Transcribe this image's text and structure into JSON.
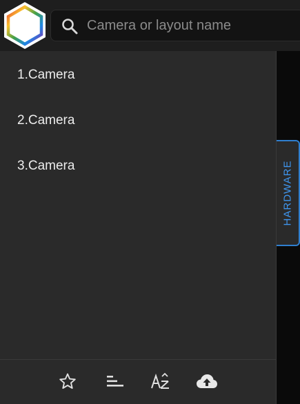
{
  "search": {
    "placeholder": "Camera or layout name",
    "value": ""
  },
  "cameras": [
    {
      "label": "1.Camera"
    },
    {
      "label": "2.Camera"
    },
    {
      "label": "3.Camera"
    }
  ],
  "hardware_tab": {
    "label": "HARDWARE"
  },
  "toolbar": {
    "icons": [
      "star-icon",
      "sort-bars-icon",
      "sort-az-icon",
      "cloud-upload-icon"
    ]
  },
  "colors": {
    "accent": "#2f7fcf",
    "accent_text": "#3f96ef",
    "panel_bg": "#2a2a2a",
    "topbar_bg": "#1e1e1e",
    "search_bg": "#131313"
  }
}
